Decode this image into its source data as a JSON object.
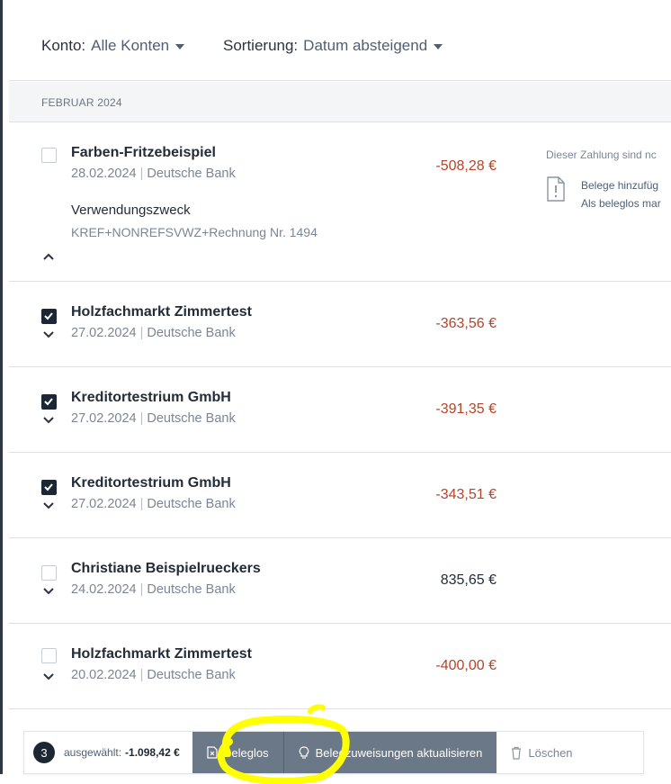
{
  "filters": {
    "account": {
      "label": "Konto:",
      "value": "Alle Konten"
    },
    "sort": {
      "label": "Sortierung:",
      "value": "Datum absteigend"
    }
  },
  "month_header": "FEBRUAR 2024",
  "transactions": [
    {
      "name": "Farben-Fritzebeispiel",
      "date": "28.02.2024",
      "bank": "Deutsche Bank",
      "amount": "-508,28 €",
      "checked": false,
      "expanded": true,
      "purpose_label": "Verwendungszweck",
      "purpose_value": "KREF+NONREFSVWZ+Rechnung Nr. 1494",
      "side_title": "Dieser Zahlung sind nc",
      "side_line1": "Belege hinzufüg",
      "side_line2": "Als beleglos mar"
    },
    {
      "name": "Holzfachmarkt Zimmertest",
      "date": "27.02.2024",
      "bank": "Deutsche Bank",
      "amount": "-363,56 €",
      "checked": true
    },
    {
      "name": "Kreditortestrium GmbH",
      "date": "27.02.2024",
      "bank": "Deutsche Bank",
      "amount": "-391,35 €",
      "checked": true
    },
    {
      "name": "Kreditortestrium GmbH",
      "date": "27.02.2024",
      "bank": "Deutsche Bank",
      "amount": "-343,51 €",
      "checked": true
    },
    {
      "name": "Christiane Beispielrueckers",
      "date": "24.02.2024",
      "bank": "Deutsche Bank",
      "amount": "835,65 €",
      "checked": false
    },
    {
      "name": "Holzfachmarkt Zimmertest",
      "date": "20.02.2024",
      "bank": "Deutsche Bank",
      "amount": "-400,00 €",
      "checked": false
    }
  ],
  "separator": "|",
  "action_bar": {
    "count": "3",
    "selected_label": "ausgewählt:",
    "selected_sum": "-1.098,42 €",
    "beleglos_label": "Beleglos",
    "update_label": "Belegzuweisungen aktualisieren",
    "delete_label": "Löschen"
  },
  "colors": {
    "negative_amount": "#b5442a",
    "dark": "#1d2733",
    "action_button": "#6b7887",
    "highlight": "#ffff00"
  },
  "icons": {
    "dropdown": "caret-down-icon",
    "expand": "chevron-down-icon",
    "collapse": "chevron-up-icon",
    "receipt_missing": "document-alert-icon",
    "beleglos": "document-x-icon",
    "update": "lightbulb-icon",
    "delete": "trash-icon"
  }
}
